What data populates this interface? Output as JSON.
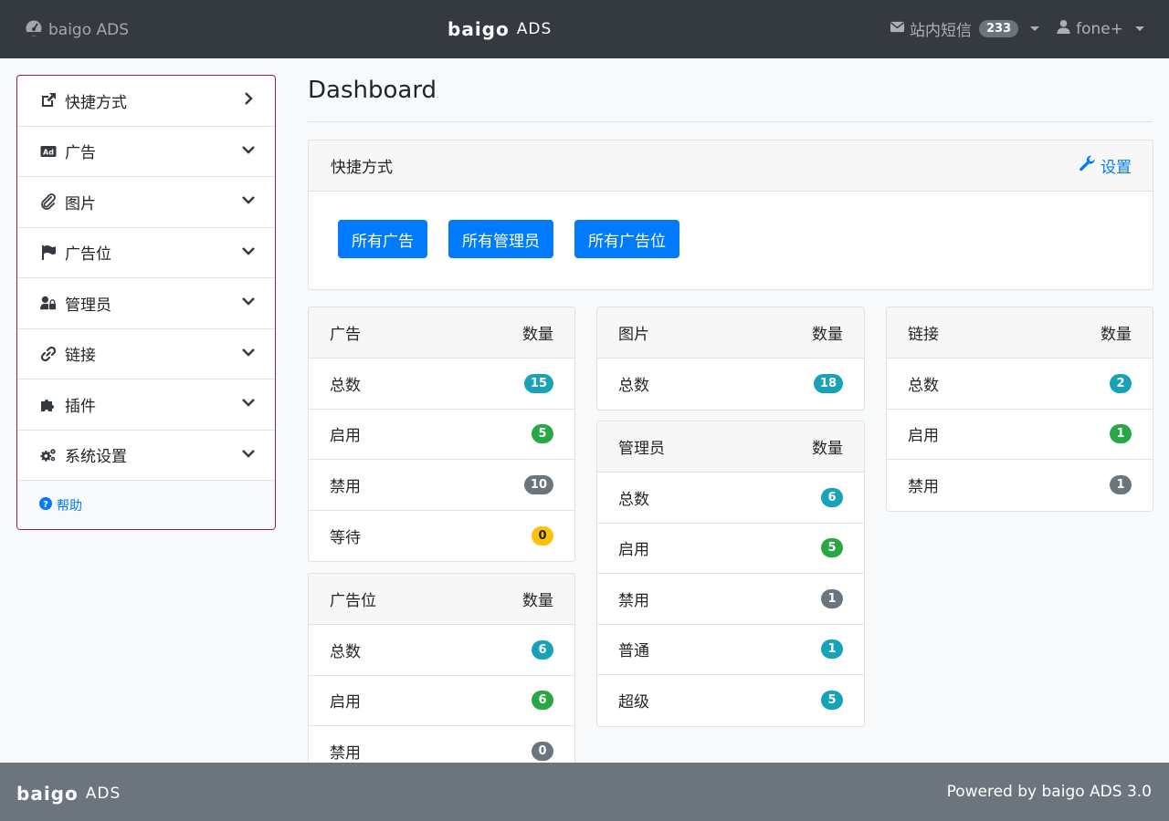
{
  "header": {
    "brand_left": "baigo ADS",
    "logo_word": "baigo",
    "logo_suffix": "ADS",
    "messages_label": "站内短信",
    "messages_count": "233",
    "user_label": "fone+"
  },
  "sidebar": {
    "items": [
      {
        "label": "快捷方式",
        "icon": "external-link-icon",
        "chevron": "chevron-right-icon"
      },
      {
        "label": "广告",
        "icon": "ad-icon",
        "chevron": "chevron-down-icon"
      },
      {
        "label": "图片",
        "icon": "paperclip-icon",
        "chevron": "chevron-down-icon"
      },
      {
        "label": "广告位",
        "icon": "flag-icon",
        "chevron": "chevron-down-icon"
      },
      {
        "label": "管理员",
        "icon": "user-lock-icon",
        "chevron": "chevron-down-icon"
      },
      {
        "label": "链接",
        "icon": "link-icon",
        "chevron": "chevron-down-icon"
      },
      {
        "label": "插件",
        "icon": "puzzle-icon",
        "chevron": "chevron-down-icon"
      },
      {
        "label": "系统设置",
        "icon": "cogs-icon",
        "chevron": "chevron-down-icon"
      }
    ],
    "help_label": "帮助"
  },
  "main": {
    "title": "Dashboard",
    "shortcuts": {
      "title": "快捷方式",
      "settings_label": "设置",
      "buttons": [
        "所有广告",
        "所有管理员",
        "所有广告位"
      ]
    }
  },
  "stats": {
    "ads": {
      "title": "广告",
      "count_label": "数量",
      "rows": [
        {
          "label": "总数",
          "value": "15",
          "color": "info"
        },
        {
          "label": "启用",
          "value": "5",
          "color": "success"
        },
        {
          "label": "禁用",
          "value": "10",
          "color": "secondary"
        },
        {
          "label": "等待",
          "value": "0",
          "color": "warning"
        }
      ]
    },
    "positions": {
      "title": "广告位",
      "count_label": "数量",
      "rows": [
        {
          "label": "总数",
          "value": "6",
          "color": "info"
        },
        {
          "label": "启用",
          "value": "6",
          "color": "success"
        },
        {
          "label": "禁用",
          "value": "0",
          "color": "secondary"
        }
      ]
    },
    "images": {
      "title": "图片",
      "count_label": "数量",
      "rows": [
        {
          "label": "总数",
          "value": "18",
          "color": "info"
        }
      ]
    },
    "admins": {
      "title": "管理员",
      "count_label": "数量",
      "rows": [
        {
          "label": "总数",
          "value": "6",
          "color": "info"
        },
        {
          "label": "启用",
          "value": "5",
          "color": "success"
        },
        {
          "label": "禁用",
          "value": "1",
          "color": "secondary"
        },
        {
          "label": "普通",
          "value": "1",
          "color": "info"
        },
        {
          "label": "超级",
          "value": "5",
          "color": "info"
        }
      ]
    },
    "links": {
      "title": "链接",
      "count_label": "数量",
      "rows": [
        {
          "label": "总数",
          "value": "2",
          "color": "info"
        },
        {
          "label": "启用",
          "value": "1",
          "color": "success"
        },
        {
          "label": "禁用",
          "value": "1",
          "color": "secondary"
        }
      ]
    }
  },
  "footer": {
    "logo_word": "baigo",
    "logo_suffix": "ADS",
    "powered_by": "Powered by baigo ADS 3.0"
  },
  "colors": {
    "navbar": "#343a40",
    "primary": "#007bff",
    "sidebar_border": "#9b1d5c",
    "footer": "#6c757d",
    "badge_info": "#17a2b8",
    "badge_success": "#28a745",
    "badge_secondary": "#6c757d",
    "badge_warning": "#ffc107"
  }
}
